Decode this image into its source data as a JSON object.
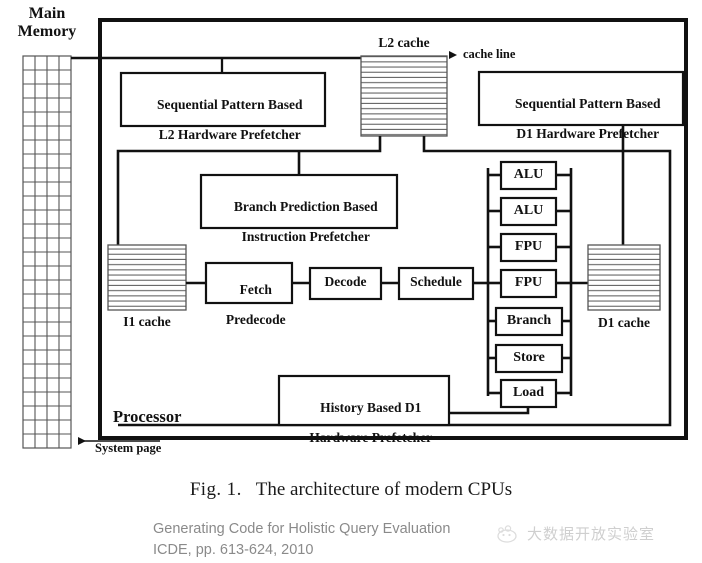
{
  "figure": {
    "caption_number": "Fig. 1.",
    "caption_text": "The architecture of modern CPUs"
  },
  "memory": {
    "title": "Main\nMemory",
    "grid_columns": 4,
    "grid_rows": 28,
    "system_page_label": "System page"
  },
  "processor": {
    "label": "Processor"
  },
  "annotations": {
    "cache_line": "cache line"
  },
  "caches": [
    {
      "name": "l2-cache",
      "label": "L2 cache",
      "stripes": 17
    },
    {
      "name": "i1-cache",
      "label": "I1 cache",
      "stripes": 13
    },
    {
      "name": "d1-cache",
      "label": "D1 cache",
      "stripes": 15
    }
  ],
  "prefetchers": [
    {
      "name": "l2-hardware-prefetcher",
      "line1": "Sequential Pattern Based",
      "line2": "L2 Hardware Prefetcher"
    },
    {
      "name": "d1-hardware-prefetcher",
      "line1": "Sequential Pattern Based",
      "line2": "D1 Hardware Prefetcher"
    },
    {
      "name": "instruction-prefetcher",
      "line1": "Branch Prediction Based",
      "line2": "Instruction Prefetcher"
    },
    {
      "name": "history-based-d1-prefetcher",
      "line1": "History Based D1",
      "line2": "Hardware Prefetcher"
    }
  ],
  "pipeline_stages": [
    {
      "name": "fetch-predecode",
      "line1": "Fetch",
      "line2": "Predecode"
    },
    {
      "name": "decode",
      "line1": "Decode",
      "line2": ""
    },
    {
      "name": "schedule",
      "line1": "Schedule",
      "line2": ""
    }
  ],
  "execution_units": [
    {
      "name": "alu-1",
      "label": "ALU"
    },
    {
      "name": "alu-2",
      "label": "ALU"
    },
    {
      "name": "fpu-1",
      "label": "FPU"
    },
    {
      "name": "fpu-2",
      "label": "FPU"
    },
    {
      "name": "branch",
      "label": "Branch"
    },
    {
      "name": "store",
      "label": "Store"
    },
    {
      "name": "load",
      "label": "Load"
    }
  ],
  "footer": {
    "line1": "Generating Code for Holistic Query Evaluation",
    "line2": "ICDE, pp. 613-624, 2010"
  },
  "watermark": {
    "text": "大数据开放实验室"
  },
  "colors": {
    "stroke": "#111111",
    "cache_stripe": "#555555",
    "footer_text": "#8a8a8a",
    "watermark_text": "#cfcfcf",
    "background": "#ffffff"
  }
}
